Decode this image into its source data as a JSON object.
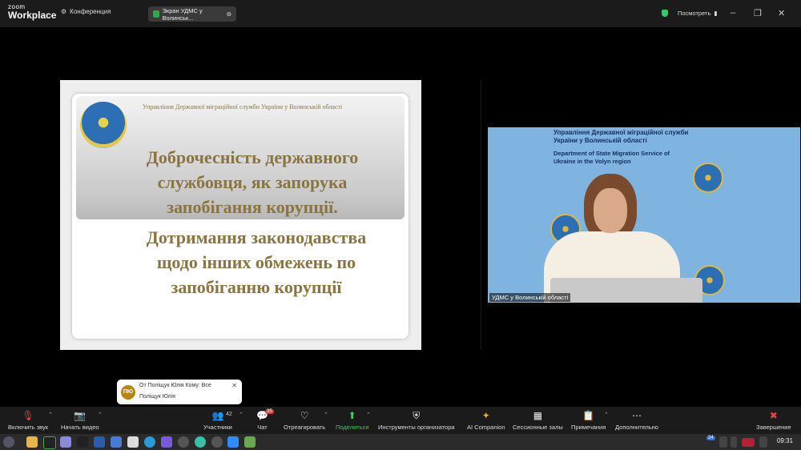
{
  "titlebar": {
    "logo_line1": "zoom",
    "logo_line2": "Workplace",
    "conference_label": "Конференция",
    "screen_share_tab": "Экран УДМС у Волинськ...",
    "view_label": "Посмотреть"
  },
  "slide": {
    "header": "Управління Державної міграційної служби України у Волинській області",
    "title_lines": [
      "Доброчесність державного",
      "службовця, як запорука",
      "запобігання корупції."
    ],
    "body_lines": [
      "Дотримання законодавства",
      "щодо інших обмежень по",
      "запобіганню корупції"
    ]
  },
  "video": {
    "participant_name": "УДМС у Волинській області",
    "dept_ua": [
      "Управління Державної міграційної служби",
      "України у Волинській області"
    ],
    "dept_en": [
      "Department of State Migration Service of",
      "Ukraine in the Volyn region"
    ]
  },
  "chat_popup": {
    "avatar_initials": "ПЮ",
    "from": "От Поліщук Юлія Кому: Все",
    "message": "Поліщук Юлія"
  },
  "toolbar": {
    "mute": "Включить звук",
    "video": "Начать видео",
    "participants": "Участники",
    "participants_count": "42",
    "chat": "Чат",
    "chat_badge": "35",
    "react": "Отреагировать",
    "share": "Поделиться",
    "host_tools": "Инструменты организатора",
    "ai": "AI Companion",
    "breakout": "Сессионные залы",
    "notes": "Примечания",
    "more": "Дополнительно",
    "end": "Завершение"
  },
  "taskbar": {
    "clock": "09:31",
    "notification_count": "24"
  }
}
